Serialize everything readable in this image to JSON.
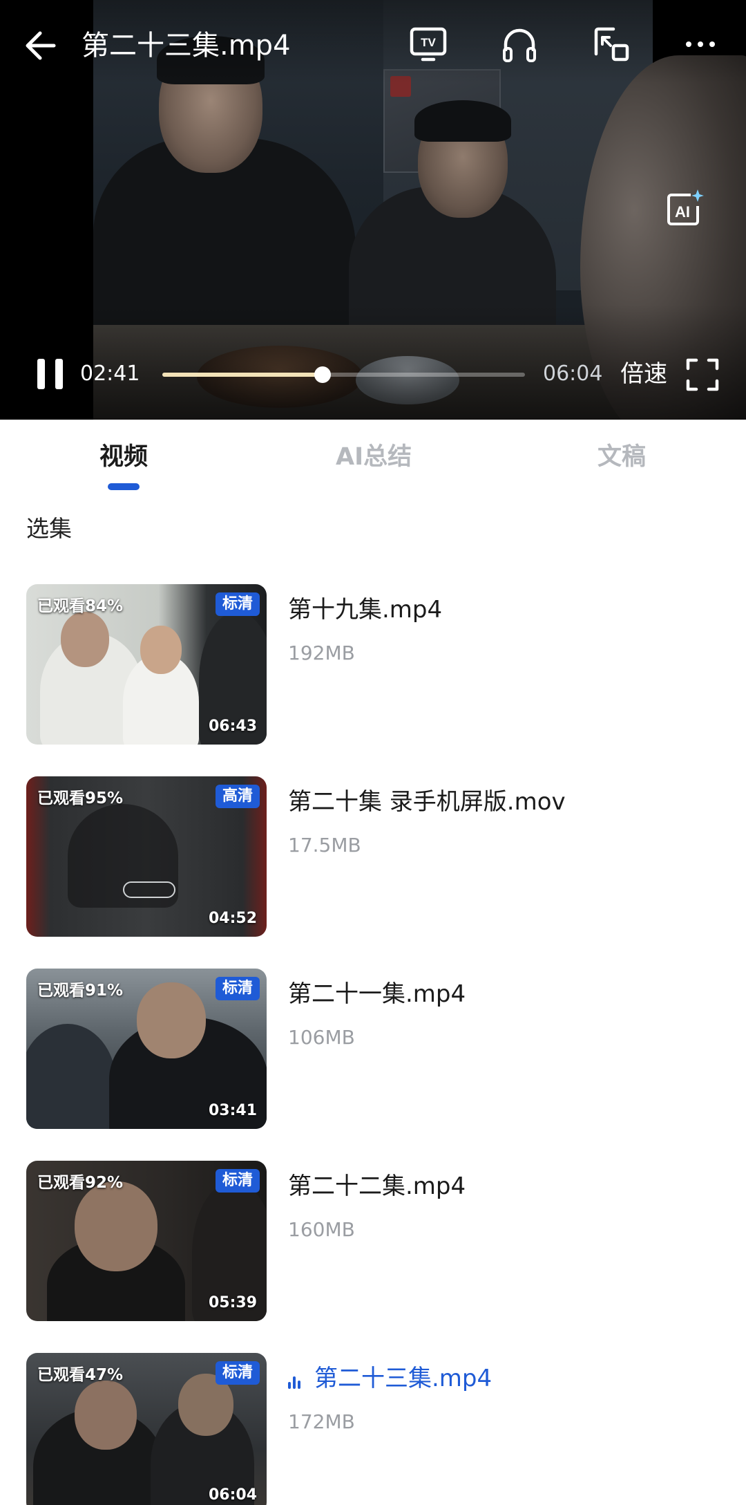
{
  "player": {
    "title": "第二十三集.mp4",
    "current_time": "02:41",
    "total_time": "06:04",
    "progress_fraction": 0.442,
    "speed_label": "倍速",
    "tv_label": "TV",
    "ai_label": "AI",
    "icons": [
      "back-arrow-icon",
      "tv-cast-icon",
      "headphones-icon",
      "pip-icon",
      "more-icon",
      "ai-spark-icon",
      "pause-icon",
      "fullscreen-icon"
    ]
  },
  "tabs": {
    "items": [
      "视频",
      "AI总结",
      "文稿"
    ],
    "active_index": 0
  },
  "section_title": "选集",
  "episodes": [
    {
      "title": "第十九集.mp4",
      "size": "192MB",
      "watched": "已观看84%",
      "quality": "标清",
      "duration": "06:43",
      "playing": false
    },
    {
      "title": "第二十集 录手机屏版.mov",
      "size": "17.5MB",
      "watched": "已观看95%",
      "quality": "高清",
      "duration": "04:52",
      "playing": false
    },
    {
      "title": "第二十一集.mp4",
      "size": "106MB",
      "watched": "已观看91%",
      "quality": "标清",
      "duration": "03:41",
      "playing": false
    },
    {
      "title": "第二十二集.mp4",
      "size": "160MB",
      "watched": "已观看92%",
      "quality": "标清",
      "duration": "05:39",
      "playing": false
    },
    {
      "title": "第二十三集.mp4",
      "size": "172MB",
      "watched": "已观看47%",
      "quality": "标清",
      "duration": "06:04",
      "playing": true
    }
  ],
  "colors": {
    "accent": "#1f5bd6",
    "progress_fill": "#f3e3b8",
    "muted_text": "#9a9da2",
    "inactive_tab": "#b5b8bd"
  }
}
